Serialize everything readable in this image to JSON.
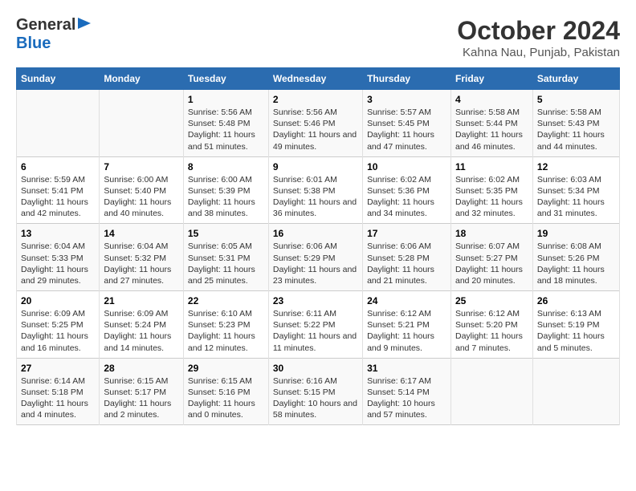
{
  "logo": {
    "line1": "General",
    "line2": "Blue"
  },
  "title": "October 2024",
  "subtitle": "Kahna Nau, Punjab, Pakistan",
  "weekdays": [
    "Sunday",
    "Monday",
    "Tuesday",
    "Wednesday",
    "Thursday",
    "Friday",
    "Saturday"
  ],
  "weeks": [
    [
      {
        "day": "",
        "info": ""
      },
      {
        "day": "",
        "info": ""
      },
      {
        "day": "1",
        "sunrise": "5:56 AM",
        "sunset": "5:48 PM",
        "daylight": "11 hours and 51 minutes."
      },
      {
        "day": "2",
        "sunrise": "5:56 AM",
        "sunset": "5:46 PM",
        "daylight": "11 hours and 49 minutes."
      },
      {
        "day": "3",
        "sunrise": "5:57 AM",
        "sunset": "5:45 PM",
        "daylight": "11 hours and 47 minutes."
      },
      {
        "day": "4",
        "sunrise": "5:58 AM",
        "sunset": "5:44 PM",
        "daylight": "11 hours and 46 minutes."
      },
      {
        "day": "5",
        "sunrise": "5:58 AM",
        "sunset": "5:43 PM",
        "daylight": "11 hours and 44 minutes."
      }
    ],
    [
      {
        "day": "6",
        "sunrise": "5:59 AM",
        "sunset": "5:41 PM",
        "daylight": "11 hours and 42 minutes."
      },
      {
        "day": "7",
        "sunrise": "6:00 AM",
        "sunset": "5:40 PM",
        "daylight": "11 hours and 40 minutes."
      },
      {
        "day": "8",
        "sunrise": "6:00 AM",
        "sunset": "5:39 PM",
        "daylight": "11 hours and 38 minutes."
      },
      {
        "day": "9",
        "sunrise": "6:01 AM",
        "sunset": "5:38 PM",
        "daylight": "11 hours and 36 minutes."
      },
      {
        "day": "10",
        "sunrise": "6:02 AM",
        "sunset": "5:36 PM",
        "daylight": "11 hours and 34 minutes."
      },
      {
        "day": "11",
        "sunrise": "6:02 AM",
        "sunset": "5:35 PM",
        "daylight": "11 hours and 32 minutes."
      },
      {
        "day": "12",
        "sunrise": "6:03 AM",
        "sunset": "5:34 PM",
        "daylight": "11 hours and 31 minutes."
      }
    ],
    [
      {
        "day": "13",
        "sunrise": "6:04 AM",
        "sunset": "5:33 PM",
        "daylight": "11 hours and 29 minutes."
      },
      {
        "day": "14",
        "sunrise": "6:04 AM",
        "sunset": "5:32 PM",
        "daylight": "11 hours and 27 minutes."
      },
      {
        "day": "15",
        "sunrise": "6:05 AM",
        "sunset": "5:31 PM",
        "daylight": "11 hours and 25 minutes."
      },
      {
        "day": "16",
        "sunrise": "6:06 AM",
        "sunset": "5:29 PM",
        "daylight": "11 hours and 23 minutes."
      },
      {
        "day": "17",
        "sunrise": "6:06 AM",
        "sunset": "5:28 PM",
        "daylight": "11 hours and 21 minutes."
      },
      {
        "day": "18",
        "sunrise": "6:07 AM",
        "sunset": "5:27 PM",
        "daylight": "11 hours and 20 minutes."
      },
      {
        "day": "19",
        "sunrise": "6:08 AM",
        "sunset": "5:26 PM",
        "daylight": "11 hours and 18 minutes."
      }
    ],
    [
      {
        "day": "20",
        "sunrise": "6:09 AM",
        "sunset": "5:25 PM",
        "daylight": "11 hours and 16 minutes."
      },
      {
        "day": "21",
        "sunrise": "6:09 AM",
        "sunset": "5:24 PM",
        "daylight": "11 hours and 14 minutes."
      },
      {
        "day": "22",
        "sunrise": "6:10 AM",
        "sunset": "5:23 PM",
        "daylight": "11 hours and 12 minutes."
      },
      {
        "day": "23",
        "sunrise": "6:11 AM",
        "sunset": "5:22 PM",
        "daylight": "11 hours and 11 minutes."
      },
      {
        "day": "24",
        "sunrise": "6:12 AM",
        "sunset": "5:21 PM",
        "daylight": "11 hours and 9 minutes."
      },
      {
        "day": "25",
        "sunrise": "6:12 AM",
        "sunset": "5:20 PM",
        "daylight": "11 hours and 7 minutes."
      },
      {
        "day": "26",
        "sunrise": "6:13 AM",
        "sunset": "5:19 PM",
        "daylight": "11 hours and 5 minutes."
      }
    ],
    [
      {
        "day": "27",
        "sunrise": "6:14 AM",
        "sunset": "5:18 PM",
        "daylight": "11 hours and 4 minutes."
      },
      {
        "day": "28",
        "sunrise": "6:15 AM",
        "sunset": "5:17 PM",
        "daylight": "11 hours and 2 minutes."
      },
      {
        "day": "29",
        "sunrise": "6:15 AM",
        "sunset": "5:16 PM",
        "daylight": "11 hours and 0 minutes."
      },
      {
        "day": "30",
        "sunrise": "6:16 AM",
        "sunset": "5:15 PM",
        "daylight": "10 hours and 58 minutes."
      },
      {
        "day": "31",
        "sunrise": "6:17 AM",
        "sunset": "5:14 PM",
        "daylight": "10 hours and 57 minutes."
      },
      {
        "day": "",
        "info": ""
      },
      {
        "day": "",
        "info": ""
      }
    ]
  ]
}
